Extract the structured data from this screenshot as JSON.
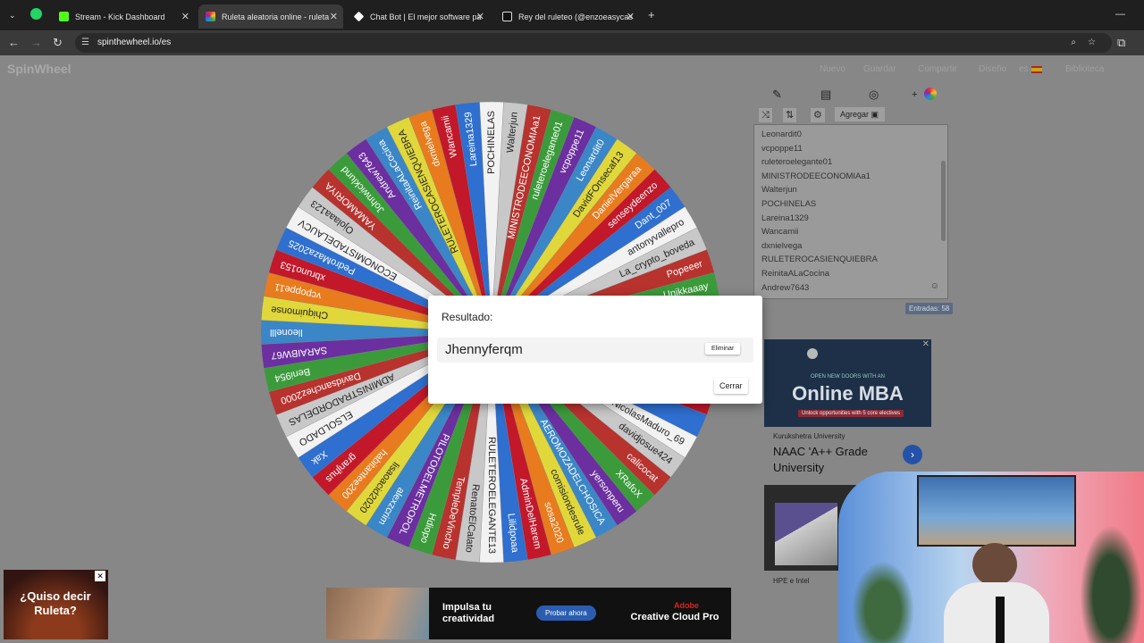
{
  "browser": {
    "tabs": [
      {
        "title": "Stream - Kick Dashboard",
        "color": "#53fc18"
      },
      {
        "title": "Ruleta aleatoria online - ruleta",
        "color": "#4285f4"
      },
      {
        "title": "Chat Bot | El mejor software pa",
        "color": "#ffffff"
      },
      {
        "title": "Rey del ruleteo (@enzoeasycas",
        "color": "#ffffff"
      }
    ],
    "url": "spinthewheel.io/es"
  },
  "site": {
    "logo": "SpinWheel",
    "nav": [
      "Nuevo",
      "Guardar",
      "Compartir",
      "Diseño",
      "es",
      "Biblioteca"
    ]
  },
  "panel": {
    "add_label": "Agregar",
    "entries": [
      "Leonardit0",
      "vcpoppe11",
      "ruleteroelegante01",
      "MINISTRODEECONOMIAa1",
      "Walterjun",
      "POCHINELAS",
      "Lareina1329",
      "Wancamii",
      "dxnielvega",
      "RULETEROCASIENQUIEBRA",
      "ReinitaALaCocina",
      "Andrew7643"
    ],
    "count_badge": "Entradas: 58"
  },
  "wheel": {
    "labels": [
      "POCHINELAS",
      "Walterjun",
      "MINISTRODEECONOMIAa1",
      "ruleteroelegante01",
      "vcpoppe11",
      "Leonardit0",
      "DavidFOnsecaf13",
      "DanielVergaraa",
      "senseydeenzo",
      "Dant_007",
      "antonyvallepro",
      "La_crypto_boveda",
      "Popeeer",
      "Unikkaaay",
      "",
      "",
      "",
      "",
      "",
      "",
      "NicolasMaduro_69",
      "davidjosue424",
      "calicocat",
      "XRafoX",
      "yersonperu",
      "AEROMOZADELCHOSICA",
      "comisiondesrule",
      "sosa2020",
      "AdminDelHarem",
      "Lilidpoaa",
      "RULETEROELEGANTE13",
      "RenatoElCalato",
      "TempleDeVincho",
      "Hdiopo",
      "PILOTODELMETROPOL",
      "alexzcrim",
      "lisaoacid2020",
      "habitantee200",
      "granjhus",
      "Xak",
      "ELSOLDADO",
      "ADMINISTRADORDELAS",
      "Davidsanchez2000",
      "Beni954",
      "SARAIBW67",
      "lleonelll",
      "Chiquimonse",
      "vcpoppe11",
      "xbruno153",
      "PedroMaza2025",
      "ECONOMISTADELAUCV",
      "Ojolaaa123",
      "YAMAMORIYA",
      "Johnwicklund",
      "Andrew7643",
      "ReinitaALaCocina",
      "RULETEROCASIENQUIEBRA",
      "dxnielvega",
      "Wancamii",
      "Lareina1329"
    ],
    "colors": [
      "#f2f2f2",
      "#c8c8c8",
      "#b8322e",
      "#3b9b3b",
      "#6b2fa0",
      "#3a86c7",
      "#e0d83a",
      "#e87b1d",
      "#c2182a",
      "#2e6fd0"
    ]
  },
  "result": {
    "heading": "Resultado:",
    "winner": "Jhennyferqm",
    "remove_label": "Eliminar",
    "close_label": "Cerrar"
  },
  "ads": {
    "mba_top": "OPEN NEW DOORS WITH AN",
    "mba_title": "Online MBA",
    "mba_sub": "Unlock opportunities with 5 core electives",
    "university": "Kurukshetra University",
    "university_headline": "NAAC 'A++ Grade University",
    "hpe": "HPE e Intel",
    "bottom_left": "¿Quiso decir Ruleta?",
    "adobe_text": "Impulsa tu creatividad",
    "adobe_button": "Probar ahora",
    "adobe_brand": "Adobe",
    "adobe_product": "Creative Cloud Pro"
  }
}
